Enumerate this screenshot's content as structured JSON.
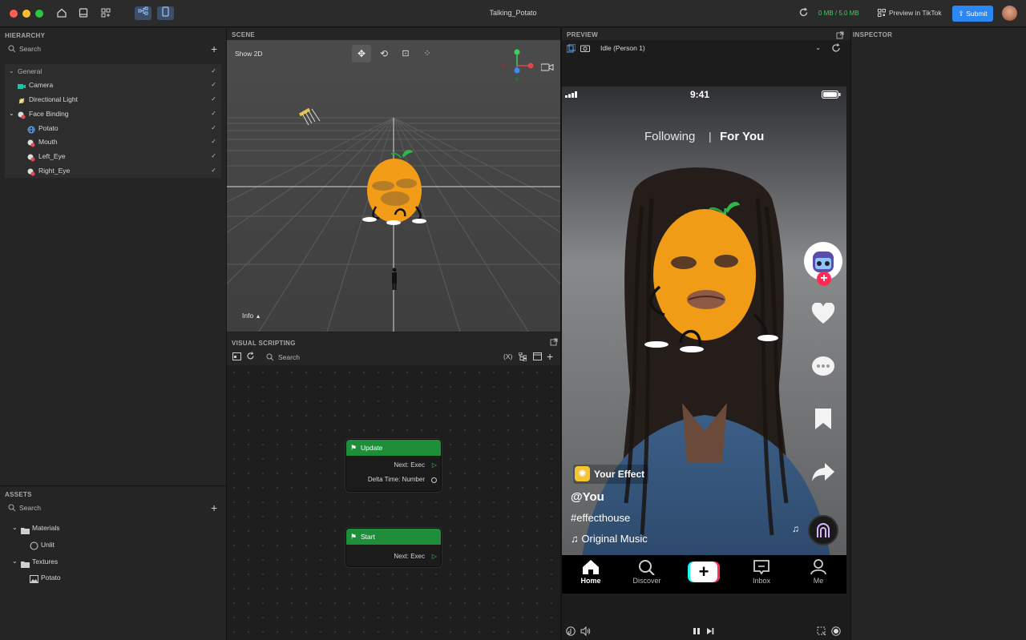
{
  "app": {
    "title": "Talking_Potato",
    "memory": "0 MB / 5.0 MB",
    "preview_label": "Preview in TikTok",
    "submit_label": "Submit"
  },
  "hierarchy": {
    "header": "HIERARCHY",
    "search_placeholder": "Search",
    "items": [
      {
        "label": "General"
      },
      {
        "label": "Camera"
      },
      {
        "label": "Directional Light"
      },
      {
        "label": "Face Binding"
      },
      {
        "label": "Potato"
      },
      {
        "label": "Mouth"
      },
      {
        "label": "Left_Eye"
      },
      {
        "label": "Right_Eye"
      }
    ]
  },
  "assets": {
    "header": "ASSETS",
    "search_placeholder": "Search",
    "items": [
      {
        "label": "Materials"
      },
      {
        "label": "Unlit"
      },
      {
        "label": "Textures"
      },
      {
        "label": "Potato"
      }
    ]
  },
  "scene": {
    "header": "SCENE",
    "show2d": "Show 2D",
    "info": "Info"
  },
  "visual_scripting": {
    "header": "VISUAL SCRIPTING",
    "search_placeholder": "Search",
    "var_label": "(X)",
    "nodes": {
      "update": {
        "title": "Update",
        "out1": "Next: Exec",
        "out2": "Delta Time: Number"
      },
      "start": {
        "title": "Start",
        "out1": "Next: Exec"
      }
    }
  },
  "preview": {
    "header": "PREVIEW",
    "dropdown": "Idle (Person 1)",
    "phone": {
      "time": "9:41",
      "tab_following": "Following",
      "tab_divider": "|",
      "tab_for_you": "For You",
      "effect": "Your Effect",
      "user": "@You",
      "hashtag": "#effecthouse",
      "music": "Original Music",
      "nav": [
        "Home",
        "Discover",
        "",
        "Inbox",
        "Me"
      ]
    }
  },
  "inspector": {
    "header": "INSPECTOR"
  },
  "colors": {
    "accent": "#2b87f2",
    "node_header": "#1f8e3b",
    "memory_text": "#3ed05a",
    "potato_orange": "#f7a21b",
    "tiktok_red": "#fe2c55"
  }
}
